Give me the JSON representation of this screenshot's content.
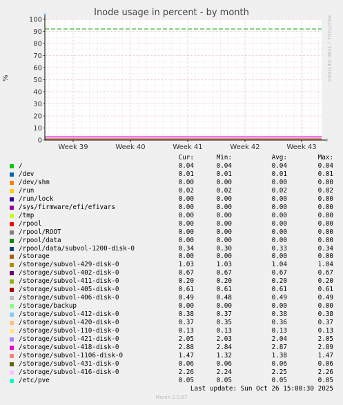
{
  "chart_data": {
    "type": "line",
    "title": "Inode usage in percent - by month",
    "ylabel": "%",
    "ylim": [
      0,
      100
    ],
    "yticks": [
      0,
      10,
      20,
      30,
      40,
      50,
      60,
      70,
      80,
      90,
      100
    ],
    "xticks": [
      "Week 39",
      "Week 40",
      "Week 41",
      "Week 42",
      "Week 43"
    ],
    "grid": true,
    "warning_line": 92,
    "colors": {
      "background": "#f0f0f0",
      "plot": "#ffffff",
      "grid": "#e8b0b0",
      "warning": "#00aa00",
      "axis": "#000000"
    },
    "columns": [
      "Cur:",
      "Min:",
      "Avg:",
      "Max:"
    ],
    "series": [
      {
        "name": "/",
        "color": "#00cc00",
        "cur": "0.04",
        "min": "0.04",
        "avg": "0.04",
        "max": "0.04"
      },
      {
        "name": "/dev",
        "color": "#0066b3",
        "cur": "0.01",
        "min": "0.01",
        "avg": "0.01",
        "max": "0.01"
      },
      {
        "name": "/dev/shm",
        "color": "#ff8000",
        "cur": "0.00",
        "min": "0.00",
        "avg": "0.00",
        "max": "0.00"
      },
      {
        "name": "/run",
        "color": "#ffcc00",
        "cur": "0.02",
        "min": "0.02",
        "avg": "0.02",
        "max": "0.02"
      },
      {
        "name": "/run/lock",
        "color": "#330099",
        "cur": "0.00",
        "min": "0.00",
        "avg": "0.00",
        "max": "0.00"
      },
      {
        "name": "/sys/firmware/efi/efivars",
        "color": "#990099",
        "cur": "0.00",
        "min": "0.00",
        "avg": "0.00",
        "max": "0.00"
      },
      {
        "name": "/tmp",
        "color": "#ccff00",
        "cur": "0.00",
        "min": "0.00",
        "avg": "0.00",
        "max": "0.00"
      },
      {
        "name": "/rpool",
        "color": "#ff0000",
        "cur": "0.00",
        "min": "0.00",
        "avg": "0.00",
        "max": "0.00"
      },
      {
        "name": "/rpool/ROOT",
        "color": "#808080",
        "cur": "0.00",
        "min": "0.00",
        "avg": "0.00",
        "max": "0.00"
      },
      {
        "name": "/rpool/data",
        "color": "#008f00",
        "cur": "0.00",
        "min": "0.00",
        "avg": "0.00",
        "max": "0.00"
      },
      {
        "name": "/rpool/data/subvol-1200-disk-0",
        "color": "#00487d",
        "cur": "0.34",
        "min": "0.30",
        "avg": "0.33",
        "max": "0.34"
      },
      {
        "name": "/storage",
        "color": "#b35a00",
        "cur": "0.00",
        "min": "0.00",
        "avg": "0.00",
        "max": "0.00"
      },
      {
        "name": "/storage/subvol-429-disk-0",
        "color": "#b38f00",
        "cur": "1.03",
        "min": "1.03",
        "avg": "1.04",
        "max": "1.04"
      },
      {
        "name": "/storage/subvol-402-disk-0",
        "color": "#6b006b",
        "cur": "0.67",
        "min": "0.67",
        "avg": "0.67",
        "max": "0.67"
      },
      {
        "name": "/storage/subvol-411-disk-0",
        "color": "#8fb300",
        "cur": "0.20",
        "min": "0.20",
        "avg": "0.20",
        "max": "0.20"
      },
      {
        "name": "/storage/subvol-405-disk-0",
        "color": "#b30000",
        "cur": "0.61",
        "min": "0.61",
        "avg": "0.61",
        "max": "0.61"
      },
      {
        "name": "/storage/subvol-406-disk-0",
        "color": "#bebebe",
        "cur": "0.49",
        "min": "0.48",
        "avg": "0.49",
        "max": "0.49"
      },
      {
        "name": "/storage/backup",
        "color": "#80ff80",
        "cur": "0.00",
        "min": "0.00",
        "avg": "0.00",
        "max": "0.00"
      },
      {
        "name": "/storage/subvol-412-disk-0",
        "color": "#80c9ff",
        "cur": "0.38",
        "min": "0.37",
        "avg": "0.38",
        "max": "0.38"
      },
      {
        "name": "/storage/subvol-420-disk-0",
        "color": "#ffc080",
        "cur": "0.37",
        "min": "0.35",
        "avg": "0.36",
        "max": "0.37"
      },
      {
        "name": "/storage/subvol-110-disk-0",
        "color": "#ffe680",
        "cur": "0.13",
        "min": "0.13",
        "avg": "0.13",
        "max": "0.13"
      },
      {
        "name": "/storage/subvol-421-disk-0",
        "color": "#aa80ff",
        "cur": "2.05",
        "min": "2.03",
        "avg": "2.04",
        "max": "2.05"
      },
      {
        "name": "/storage/subvol-418-disk-0",
        "color": "#ee00cc",
        "cur": "2.88",
        "min": "2.84",
        "avg": "2.87",
        "max": "2.89"
      },
      {
        "name": "/storage/subvol-1106-disk-0",
        "color": "#ff8080",
        "cur": "1.47",
        "min": "1.32",
        "avg": "1.38",
        "max": "1.47"
      },
      {
        "name": "/storage/subvol-431-disk-0",
        "color": "#666600",
        "cur": "0.06",
        "min": "0.06",
        "avg": "0.06",
        "max": "0.06"
      },
      {
        "name": "/storage/subvol-416-disk-0",
        "color": "#ffbfff",
        "cur": "2.26",
        "min": "2.24",
        "avg": "2.25",
        "max": "2.26"
      },
      {
        "name": "/etc/pve",
        "color": "#00ffcc",
        "cur": "0.05",
        "min": "0.05",
        "avg": "0.05",
        "max": "0.05"
      }
    ]
  },
  "watermark": "RRDTOOL / TOBI OETIKER",
  "last_update": "Last update: Sun Oct 26 15:00:30 2025",
  "footer": "Munin 2.0.67"
}
